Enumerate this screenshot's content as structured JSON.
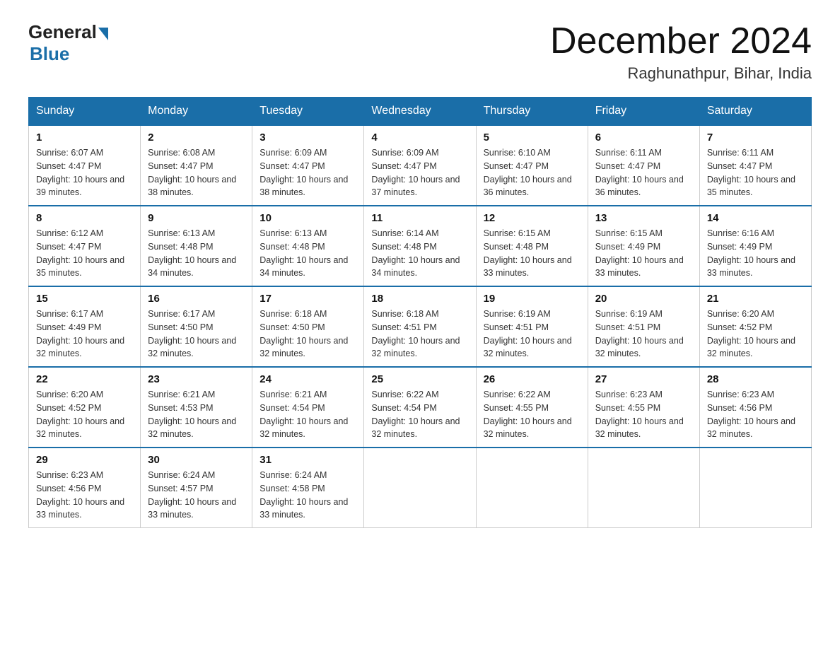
{
  "logo": {
    "general": "General",
    "blue": "Blue"
  },
  "title": {
    "month_year": "December 2024",
    "location": "Raghunathpur, Bihar, India"
  },
  "days_of_week": [
    "Sunday",
    "Monday",
    "Tuesday",
    "Wednesday",
    "Thursday",
    "Friday",
    "Saturday"
  ],
  "weeks": [
    [
      {
        "day": "1",
        "sunrise": "6:07 AM",
        "sunset": "4:47 PM",
        "daylight": "10 hours and 39 minutes."
      },
      {
        "day": "2",
        "sunrise": "6:08 AM",
        "sunset": "4:47 PM",
        "daylight": "10 hours and 38 minutes."
      },
      {
        "day": "3",
        "sunrise": "6:09 AM",
        "sunset": "4:47 PM",
        "daylight": "10 hours and 38 minutes."
      },
      {
        "day": "4",
        "sunrise": "6:09 AM",
        "sunset": "4:47 PM",
        "daylight": "10 hours and 37 minutes."
      },
      {
        "day": "5",
        "sunrise": "6:10 AM",
        "sunset": "4:47 PM",
        "daylight": "10 hours and 36 minutes."
      },
      {
        "day": "6",
        "sunrise": "6:11 AM",
        "sunset": "4:47 PM",
        "daylight": "10 hours and 36 minutes."
      },
      {
        "day": "7",
        "sunrise": "6:11 AM",
        "sunset": "4:47 PM",
        "daylight": "10 hours and 35 minutes."
      }
    ],
    [
      {
        "day": "8",
        "sunrise": "6:12 AM",
        "sunset": "4:47 PM",
        "daylight": "10 hours and 35 minutes."
      },
      {
        "day": "9",
        "sunrise": "6:13 AM",
        "sunset": "4:48 PM",
        "daylight": "10 hours and 34 minutes."
      },
      {
        "day": "10",
        "sunrise": "6:13 AM",
        "sunset": "4:48 PM",
        "daylight": "10 hours and 34 minutes."
      },
      {
        "day": "11",
        "sunrise": "6:14 AM",
        "sunset": "4:48 PM",
        "daylight": "10 hours and 34 minutes."
      },
      {
        "day": "12",
        "sunrise": "6:15 AM",
        "sunset": "4:48 PM",
        "daylight": "10 hours and 33 minutes."
      },
      {
        "day": "13",
        "sunrise": "6:15 AM",
        "sunset": "4:49 PM",
        "daylight": "10 hours and 33 minutes."
      },
      {
        "day": "14",
        "sunrise": "6:16 AM",
        "sunset": "4:49 PM",
        "daylight": "10 hours and 33 minutes."
      }
    ],
    [
      {
        "day": "15",
        "sunrise": "6:17 AM",
        "sunset": "4:49 PM",
        "daylight": "10 hours and 32 minutes."
      },
      {
        "day": "16",
        "sunrise": "6:17 AM",
        "sunset": "4:50 PM",
        "daylight": "10 hours and 32 minutes."
      },
      {
        "day": "17",
        "sunrise": "6:18 AM",
        "sunset": "4:50 PM",
        "daylight": "10 hours and 32 minutes."
      },
      {
        "day": "18",
        "sunrise": "6:18 AM",
        "sunset": "4:51 PM",
        "daylight": "10 hours and 32 minutes."
      },
      {
        "day": "19",
        "sunrise": "6:19 AM",
        "sunset": "4:51 PM",
        "daylight": "10 hours and 32 minutes."
      },
      {
        "day": "20",
        "sunrise": "6:19 AM",
        "sunset": "4:51 PM",
        "daylight": "10 hours and 32 minutes."
      },
      {
        "day": "21",
        "sunrise": "6:20 AM",
        "sunset": "4:52 PM",
        "daylight": "10 hours and 32 minutes."
      }
    ],
    [
      {
        "day": "22",
        "sunrise": "6:20 AM",
        "sunset": "4:52 PM",
        "daylight": "10 hours and 32 minutes."
      },
      {
        "day": "23",
        "sunrise": "6:21 AM",
        "sunset": "4:53 PM",
        "daylight": "10 hours and 32 minutes."
      },
      {
        "day": "24",
        "sunrise": "6:21 AM",
        "sunset": "4:54 PM",
        "daylight": "10 hours and 32 minutes."
      },
      {
        "day": "25",
        "sunrise": "6:22 AM",
        "sunset": "4:54 PM",
        "daylight": "10 hours and 32 minutes."
      },
      {
        "day": "26",
        "sunrise": "6:22 AM",
        "sunset": "4:55 PM",
        "daylight": "10 hours and 32 minutes."
      },
      {
        "day": "27",
        "sunrise": "6:23 AM",
        "sunset": "4:55 PM",
        "daylight": "10 hours and 32 minutes."
      },
      {
        "day": "28",
        "sunrise": "6:23 AM",
        "sunset": "4:56 PM",
        "daylight": "10 hours and 32 minutes."
      }
    ],
    [
      {
        "day": "29",
        "sunrise": "6:23 AM",
        "sunset": "4:56 PM",
        "daylight": "10 hours and 33 minutes."
      },
      {
        "day": "30",
        "sunrise": "6:24 AM",
        "sunset": "4:57 PM",
        "daylight": "10 hours and 33 minutes."
      },
      {
        "day": "31",
        "sunrise": "6:24 AM",
        "sunset": "4:58 PM",
        "daylight": "10 hours and 33 minutes."
      },
      null,
      null,
      null,
      null
    ]
  ]
}
